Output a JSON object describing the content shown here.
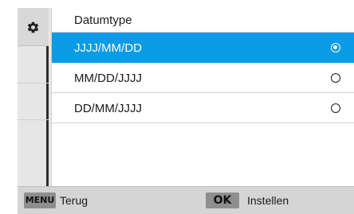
{
  "sidebar": {
    "active_icon": "gear-icon"
  },
  "panel": {
    "title": "Datumtype",
    "options": [
      {
        "label": "JJJJ/MM/DD",
        "selected": true
      },
      {
        "label": "MM/DD/JJJJ",
        "selected": false
      },
      {
        "label": "DD/MM/JJJJ",
        "selected": false
      }
    ]
  },
  "footer": {
    "menu_key": "MENU",
    "back_label": "Terug",
    "ok_key": "OK",
    "set_label": "Instellen"
  },
  "colors": {
    "accent": "#0a9be6"
  }
}
